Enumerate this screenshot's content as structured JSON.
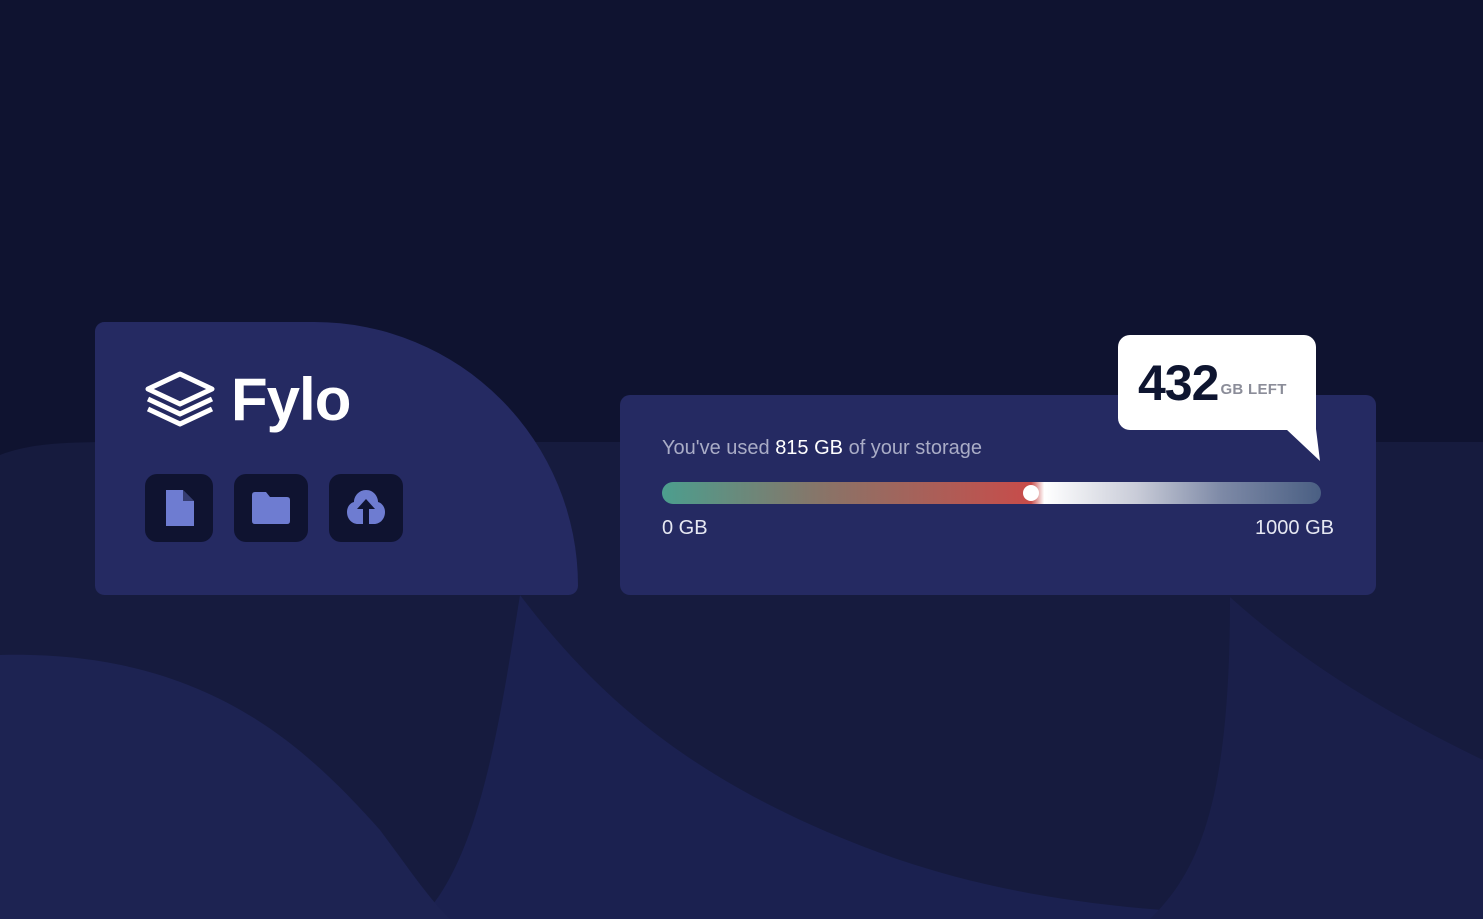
{
  "brand": {
    "name": "Fylo",
    "logo_icon": "stacked-layers-icon"
  },
  "toolbar": {
    "buttons": [
      {
        "icon": "document-icon",
        "label": ""
      },
      {
        "icon": "folder-icon",
        "label": ""
      },
      {
        "icon": "cloud-upload-icon",
        "label": ""
      }
    ]
  },
  "storage": {
    "prefix": "You've used ",
    "used": "815 GB",
    "suffix": " of your storage",
    "min_label": "0 GB",
    "max_label": "1000 GB",
    "fill_fraction": 0.56,
    "remaining": "432",
    "remaining_unit": "GB LEFT"
  },
  "colors": {
    "background": "#0f1330",
    "panel": "#252a62",
    "icon_tile": "#0f1330",
    "icon_fill": "#6e7cd1",
    "meter_start": "#4c9e8e",
    "meter_end": "#c84c4a",
    "text_muted": "#a9acc6"
  }
}
